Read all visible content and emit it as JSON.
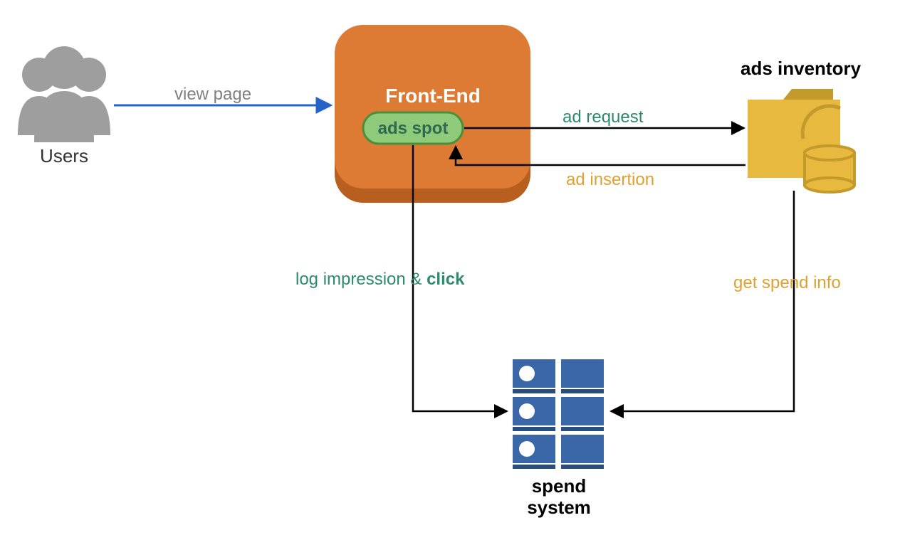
{
  "nodes": {
    "users": {
      "label": "Users"
    },
    "frontend": {
      "title": "Front-End",
      "ads_spot": "ads spot"
    },
    "ads_inventory": {
      "label": "ads inventory"
    },
    "spend_system": {
      "label_line1": "spend",
      "label_line2": "system"
    }
  },
  "edges": {
    "view_page": "view page",
    "ad_request": "ad request",
    "ad_insertion": "ad insertion",
    "log_impression_prefix": "log impression & ",
    "log_impression_bold": "click",
    "get_spend_info": "get spend info"
  },
  "colors": {
    "gray": "#9e9e9e",
    "blue_arrow": "#2563c9",
    "orange": "#dd7a33",
    "orange_dark": "#b85f1f",
    "green_fill": "#8fc97a",
    "green_stroke": "#4a8f3a",
    "teal_text": "#2d8a6f",
    "amber": "#e8b93f",
    "amber_dark": "#c49a2a",
    "server_blue": "#3a67a8"
  }
}
